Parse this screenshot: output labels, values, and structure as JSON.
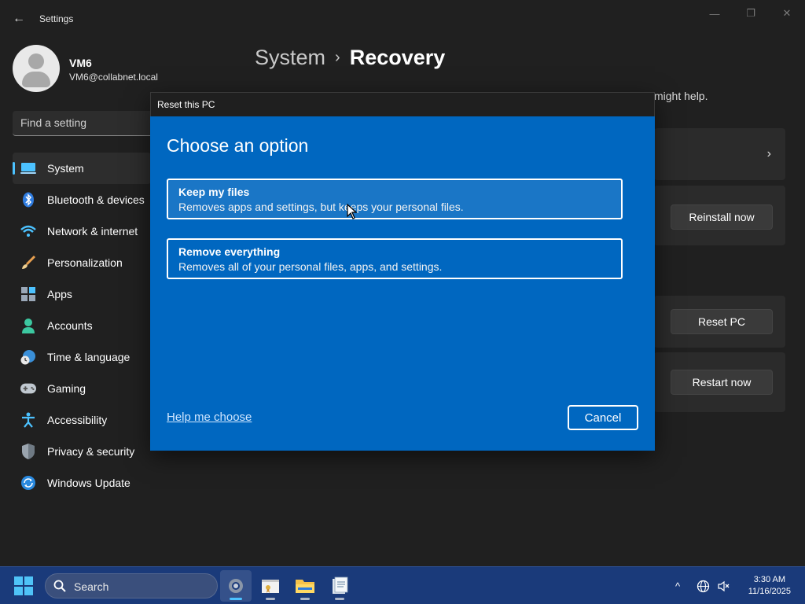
{
  "window": {
    "title": "Settings",
    "back_glyph": "←",
    "minimize_glyph": "—",
    "maximize_glyph": "❐",
    "close_glyph": "✕"
  },
  "user": {
    "name": "VM6",
    "email": "VM6@collabnet.local"
  },
  "search": {
    "placeholder": "Find a setting"
  },
  "nav": [
    {
      "label": "System",
      "icon": "laptop-icon",
      "active": true
    },
    {
      "label": "Bluetooth & devices",
      "icon": "bluetooth-icon"
    },
    {
      "label": "Network & internet",
      "icon": "wifi-icon"
    },
    {
      "label": "Personalization",
      "icon": "brush-icon"
    },
    {
      "label": "Apps",
      "icon": "apps-icon"
    },
    {
      "label": "Accounts",
      "icon": "person-icon"
    },
    {
      "label": "Time & language",
      "icon": "globe-clock-icon"
    },
    {
      "label": "Gaming",
      "icon": "gamepad-icon"
    },
    {
      "label": "Accessibility",
      "icon": "accessibility-icon"
    },
    {
      "label": "Privacy & security",
      "icon": "shield-icon"
    },
    {
      "label": "Windows Update",
      "icon": "update-icon"
    }
  ],
  "page": {
    "breadcrumb_parent": "System",
    "breadcrumb_sep": "›",
    "breadcrumb_current": "Recovery",
    "desc_tail": "might help.",
    "buttons": {
      "reinstall": "Reinstall now",
      "reset": "Reset PC",
      "restart": "Restart now"
    }
  },
  "dialog": {
    "title": "Reset this PC",
    "heading": "Choose an option",
    "options": [
      {
        "title": "Keep my files",
        "desc": "Removes apps and settings, but keeps your personal files."
      },
      {
        "title": "Remove everything",
        "desc": "Removes all of your personal files, apps, and settings."
      }
    ],
    "help_link": "Help me choose",
    "cancel": "Cancel"
  },
  "taskbar": {
    "search_label": "Search",
    "apps": [
      "settings-icon",
      "certificate-app-icon",
      "file-explorer-icon",
      "notepad-app-icon"
    ],
    "time": "3:30 AM",
    "date": "11/16/2025",
    "tray": {
      "chevron": "^"
    }
  },
  "colors": {
    "accent": "#4cc2ff",
    "dialog_blue": "#0067c0",
    "background": "#202020",
    "taskbar": "#1a3a7a"
  }
}
